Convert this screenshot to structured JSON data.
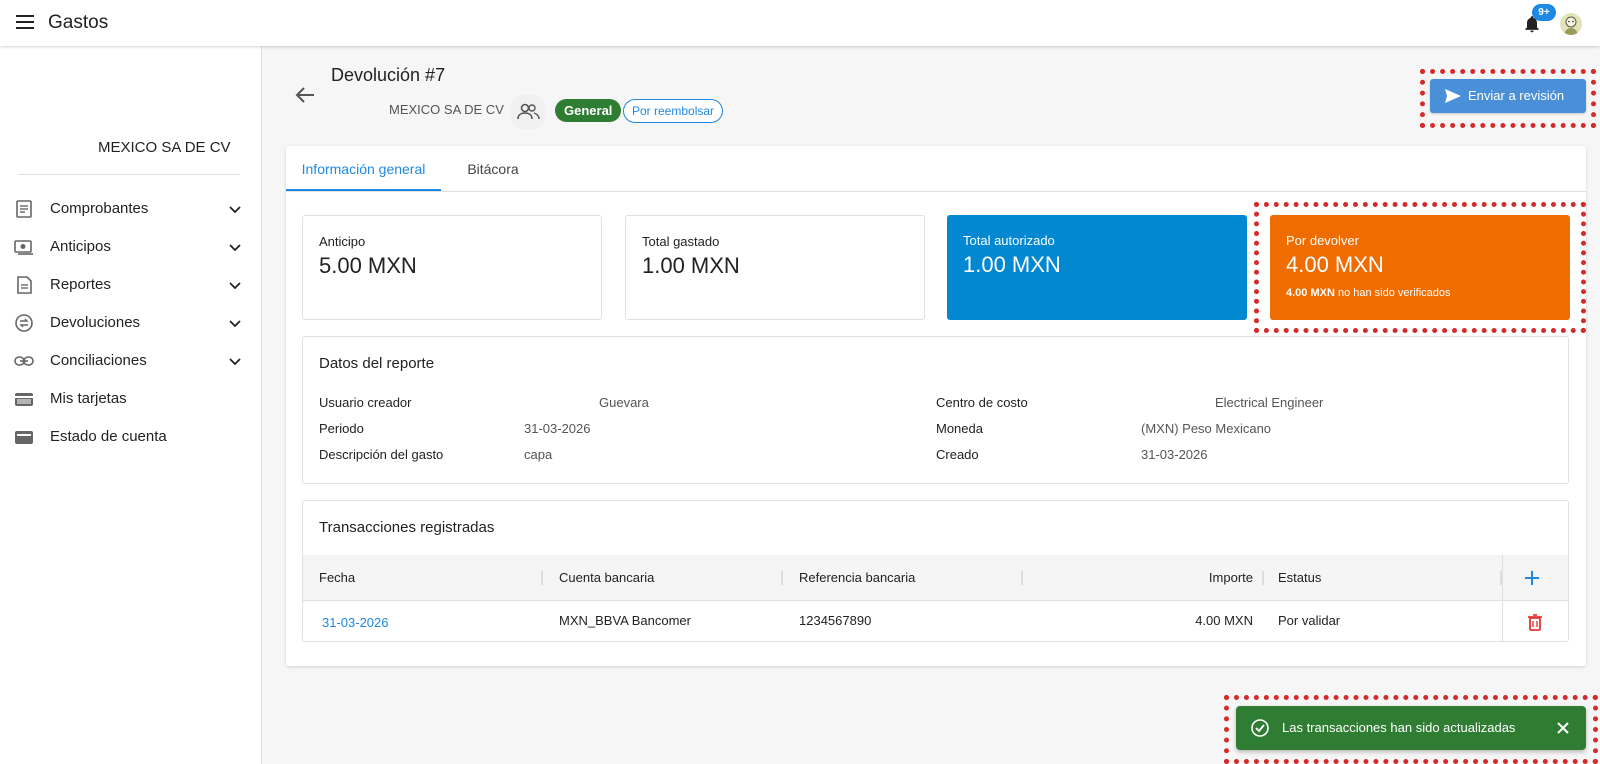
{
  "topbar": {
    "title": "Gastos",
    "notifications_badge": "9+"
  },
  "sidebar": {
    "company": "MEXICO SA DE CV",
    "items": [
      {
        "label": "Comprobantes",
        "icon": "receipt-icon",
        "expandable": true
      },
      {
        "label": "Anticipos",
        "icon": "money-icon",
        "expandable": true
      },
      {
        "label": "Reportes",
        "icon": "report-icon",
        "expandable": true
      },
      {
        "label": "Devoluciones",
        "icon": "exchange-icon",
        "expandable": true
      },
      {
        "label": "Conciliaciones",
        "icon": "link-icon",
        "expandable": true
      },
      {
        "label": "Mis tarjetas",
        "icon": "card-icon",
        "expandable": false
      },
      {
        "label": "Estado de cuenta",
        "icon": "wallet-icon",
        "expandable": false
      }
    ]
  },
  "header": {
    "title": "Devolución #7",
    "company": "MEXICO SA DE CV",
    "chip_general": "General",
    "chip_status": "Por reembolsar",
    "send_button": "Enviar a revisión"
  },
  "tabs": [
    {
      "label": "Información general",
      "active": true
    },
    {
      "label": "Bitácora",
      "active": false
    }
  ],
  "stats": {
    "anticipo": {
      "label": "Anticipo",
      "value": "5.00 MXN"
    },
    "gastado": {
      "label": "Total gastado",
      "value": "1.00 MXN"
    },
    "autorizado": {
      "label": "Total autorizado",
      "value": "1.00 MXN",
      "color": "#0288d1"
    },
    "devolver": {
      "label": "Por devolver",
      "value": "4.00 MXN",
      "note_amount": "4.00 MXN",
      "note_text": "no han sido verificados",
      "color": "#ef6c00"
    }
  },
  "datos": {
    "title": "Datos del reporte",
    "usuario_label": "Usuario creador",
    "usuario_value": "Guevara",
    "periodo_label": "Periodo",
    "periodo_value": "31-03-2026",
    "descripcion_label": "Descripción del gasto",
    "descripcion_value": "capa",
    "centro_label": "Centro de costo",
    "centro_value": "Electrical Engineer",
    "moneda_label": "Moneda",
    "moneda_value": "(MXN) Peso Mexicano",
    "creado_label": "Creado",
    "creado_value": "31-03-2026"
  },
  "transacciones": {
    "title": "Transacciones registradas",
    "columns": [
      "Fecha",
      "Cuenta bancaria",
      "Referencia bancaria",
      "Importe",
      "Estatus"
    ],
    "rows": [
      {
        "fecha": "31-03-2026",
        "cuenta": "MXN_BBVA Bancomer",
        "referencia": "1234567890",
        "importe": "4.00 MXN",
        "estatus": "Por validar"
      }
    ]
  },
  "snackbar": {
    "message": "Las transacciones han sido actualizadas",
    "color": "#2e7d32"
  }
}
